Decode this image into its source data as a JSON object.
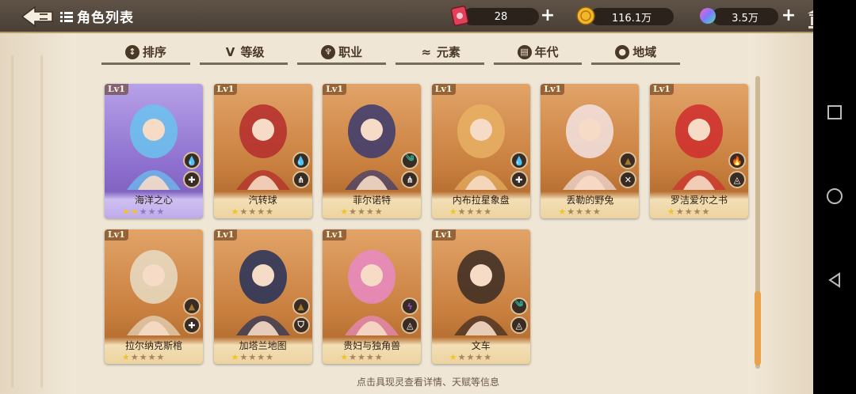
{
  "header": {
    "title": "角色列表",
    "resources": [
      {
        "name": "ticket",
        "value": "28",
        "icon": "ticket-icon",
        "has_plus": true
      },
      {
        "name": "gold",
        "value": "116.1万",
        "icon": "gold-coin-icon",
        "has_plus": false
      },
      {
        "name": "crystal",
        "value": "3.5万",
        "icon": "crystal-icon",
        "has_plus": true
      }
    ]
  },
  "tabs": [
    {
      "label": "排序",
      "icon": "sort-icon"
    },
    {
      "label": "等级",
      "icon": "level-icon"
    },
    {
      "label": "职业",
      "icon": "class-icon"
    },
    {
      "label": "元素",
      "icon": "element-icon"
    },
    {
      "label": "年代",
      "icon": "era-icon"
    },
    {
      "label": "地域",
      "icon": "region-icon"
    }
  ],
  "cards": [
    {
      "level": "Lv1",
      "name": "海洋之心",
      "stars": 2,
      "max_stars": 5,
      "rarity": "purple",
      "element": "water",
      "class": "healer",
      "art": "#6ac3ef"
    },
    {
      "level": "Lv1",
      "name": "汽转球",
      "stars": 1,
      "max_stars": 5,
      "rarity": "orange",
      "element": "water",
      "class": "warrior",
      "art": "#b42b2b"
    },
    {
      "level": "Lv1",
      "name": "菲尔诺特",
      "stars": 1,
      "max_stars": 5,
      "rarity": "orange",
      "element": "wind",
      "class": "warrior",
      "art": "#3a3a6e"
    },
    {
      "level": "Lv1",
      "name": "内布拉星象盘",
      "stars": 1,
      "max_stars": 5,
      "rarity": "orange",
      "element": "water",
      "class": "healer",
      "art": "#e8b064"
    },
    {
      "level": "Lv1",
      "name": "丢勒的野兔",
      "stars": 1,
      "max_stars": 5,
      "rarity": "orange",
      "element": "earth",
      "class": "assassin",
      "art": "#f3e3e3"
    },
    {
      "level": "Lv1",
      "name": "罗洁爱尔之书",
      "stars": 1,
      "max_stars": 5,
      "rarity": "orange",
      "element": "fire",
      "class": "mage",
      "art": "#cf2d2d"
    },
    {
      "level": "Lv1",
      "name": "拉尔纳克斯棺",
      "stars": 1,
      "max_stars": 5,
      "rarity": "orange",
      "element": "earth",
      "class": "healer",
      "art": "#e8dcc4"
    },
    {
      "level": "Lv1",
      "name": "加塔兰地图",
      "stars": 1,
      "max_stars": 5,
      "rarity": "orange",
      "element": "earth",
      "class": "guardian",
      "art": "#24305a"
    },
    {
      "level": "Lv1",
      "name": "贵妇与独角兽",
      "stars": 1,
      "max_stars": 5,
      "rarity": "orange",
      "element": "thunder",
      "class": "mage",
      "art": "#e98ac5"
    },
    {
      "level": "Lv1",
      "name": "文车",
      "stars": 1,
      "max_stars": 5,
      "rarity": "orange",
      "element": "wind",
      "class": "mage",
      "art": "#3a2a22"
    }
  ],
  "hint": "点击具现灵查看详情、天赋等信息",
  "colors": {
    "accent": "#e8a24b",
    "topbar": "#4a3f35",
    "background": "#efe6d6"
  }
}
